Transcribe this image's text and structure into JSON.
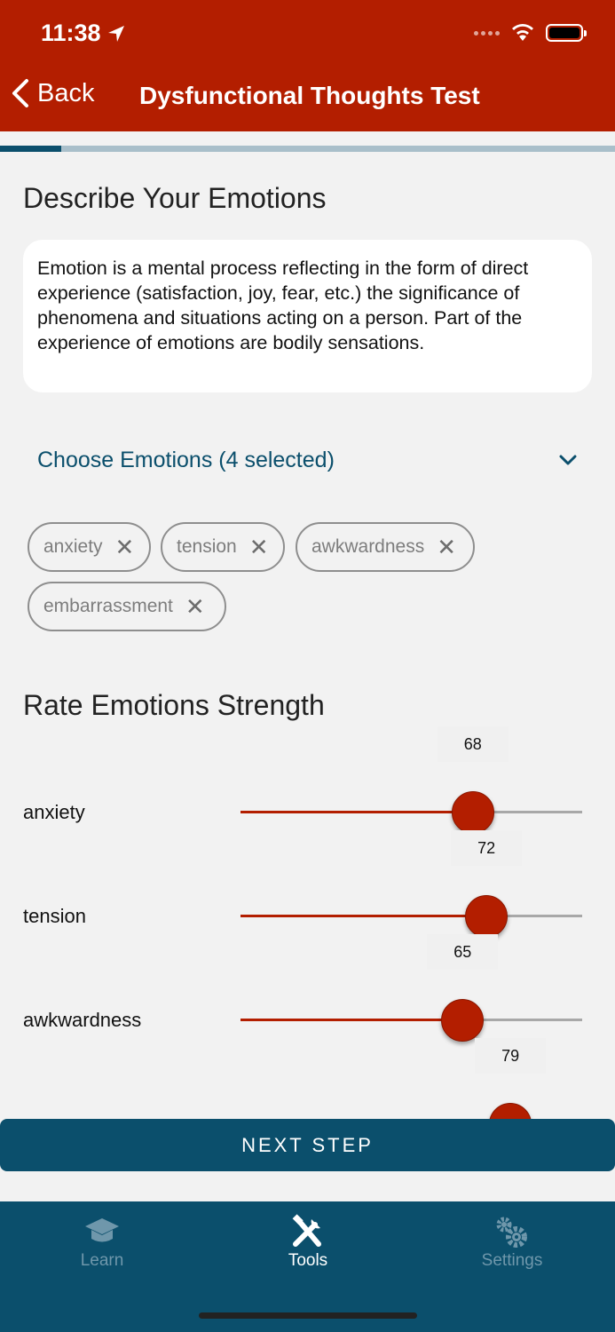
{
  "status": {
    "time": "11:38"
  },
  "nav": {
    "back_label": "Back",
    "title": "Dysfunctional Thoughts Test",
    "progress_fraction": 0.1
  },
  "emotions": {
    "heading": "Describe Your Emotions",
    "description": "Emotion is a mental process reflecting in the form of direct experience (satisfaction, joy, fear, etc.) the significance of phenomena and situations acting on a person. Part of the experience of emotions are bodily sensations.",
    "choose_label": "Choose Emotions (4 selected)",
    "chips": [
      "anxiety",
      "tension",
      "awkwardness",
      "embarrassment"
    ],
    "chip_remove": "✕"
  },
  "rating": {
    "heading": "Rate Emotions Strength",
    "items": [
      {
        "label": "anxiety",
        "value": 68
      },
      {
        "label": "tension",
        "value": 72
      },
      {
        "label": "awkwardness",
        "value": 65
      },
      {
        "label": "embarrassment",
        "value": 79
      }
    ]
  },
  "actions": {
    "next_label": "NEXT STEP"
  },
  "tabs": [
    {
      "label": "Learn",
      "icon": "graduation-cap-icon",
      "active": false
    },
    {
      "label": "Tools",
      "icon": "tools-icon",
      "active": true
    },
    {
      "label": "Settings",
      "icon": "gears-icon",
      "active": false
    }
  ],
  "colors": {
    "brand_red": "#b31e00",
    "brand_blue": "#0b4f6c",
    "background": "#f2f2f2"
  }
}
